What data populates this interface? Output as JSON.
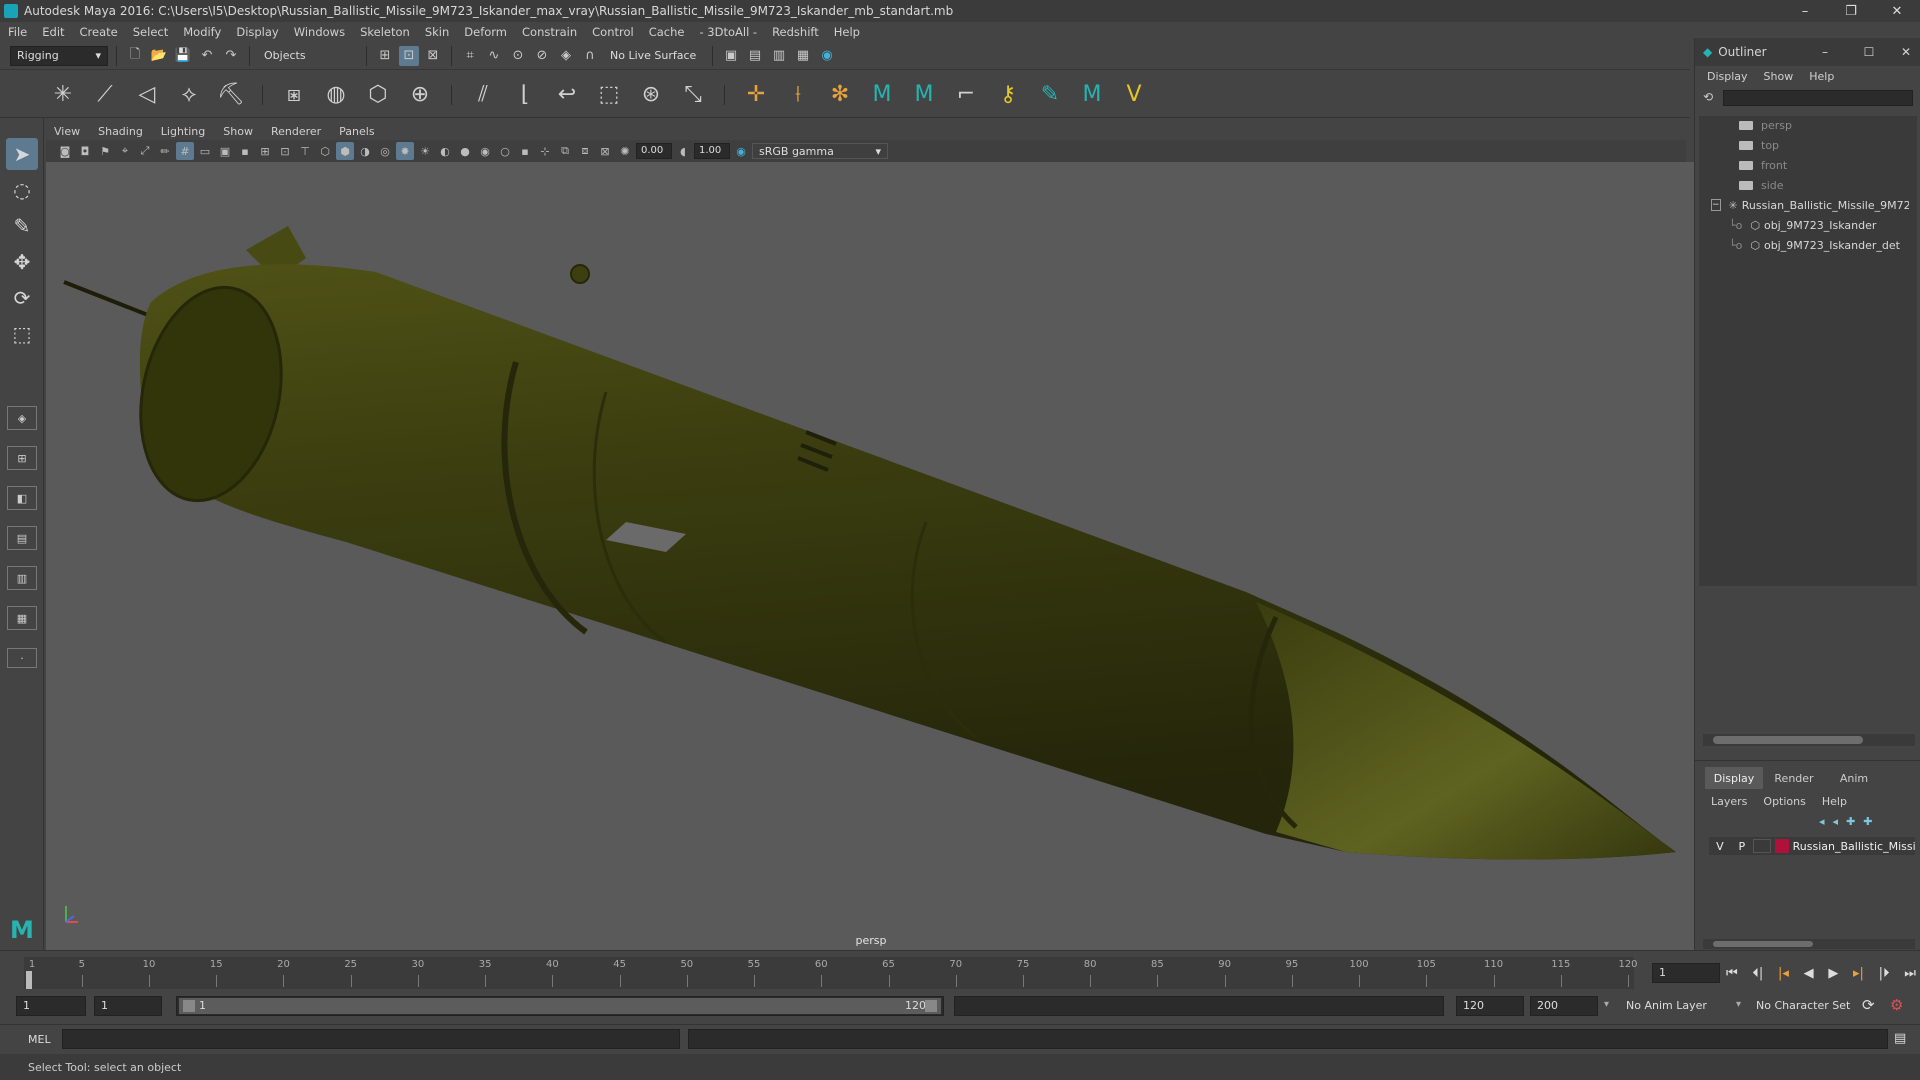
{
  "window": {
    "title": "Autodesk Maya 2016: C:\\Users\\I5\\Desktop\\Russian_Ballistic_Missile_9M723_Iskander_max_vray\\Russian_Ballistic_Missile_9M723_Iskander_mb_standart.mb",
    "minimize": "–",
    "restore": "❐",
    "close": "✕"
  },
  "menubar": [
    "File",
    "Edit",
    "Create",
    "Select",
    "Modify",
    "Display",
    "Windows",
    "Skeleton",
    "Skin",
    "Deform",
    "Constrain",
    "Control",
    "Cache",
    "- 3DtoAll -",
    "Redshift",
    "Help"
  ],
  "statusline": {
    "menuset": "Rigging",
    "selection_mode": "Objects",
    "live_surface": "No Live Surface"
  },
  "panel": {
    "menus": [
      "View",
      "Shading",
      "Lighting",
      "Show",
      "Renderer",
      "Panels"
    ],
    "exposure": "0.00",
    "gamma": "1.00",
    "colorspace": "sRGB gamma",
    "camera_label": "persp"
  },
  "outliner": {
    "title": "Outliner",
    "menus": [
      "Display",
      "Show",
      "Help"
    ],
    "cameras": [
      "persp",
      "top",
      "front",
      "side"
    ],
    "group": "Russian_Ballistic_Missile_9M723",
    "children": [
      "obj_9M723_Iskander",
      "obj_9M723_Iskander_det"
    ]
  },
  "layers": {
    "tabs": [
      "Display",
      "Render",
      "Anim"
    ],
    "menus": [
      "Layers",
      "Options",
      "Help"
    ],
    "row": {
      "v": "V",
      "p": "P",
      "name": "Russian_Ballistic_Missi",
      "color": "#b0113b"
    }
  },
  "timeline": {
    "tick_labels": [
      "1",
      "5",
      "10",
      "15",
      "20",
      "25",
      "30",
      "35",
      "40",
      "45",
      "50",
      "55",
      "60",
      "65",
      "70",
      "75",
      "80",
      "85",
      "90",
      "95",
      "100",
      "105",
      "110",
      "115",
      "120"
    ],
    "current_frame": "1"
  },
  "range": {
    "start": "1",
    "playback_start": "1",
    "slider_start": "1",
    "slider_end": "120",
    "playback_end": "120",
    "end": "200",
    "anim_layer": "No Anim Layer",
    "character_set": "No Character Set"
  },
  "mel": {
    "label": "MEL"
  },
  "helpline": {
    "text": "Select Tool: select an object"
  }
}
